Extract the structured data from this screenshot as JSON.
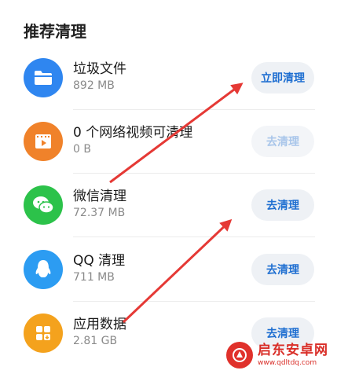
{
  "section": {
    "title": "推荐清理"
  },
  "items": [
    {
      "title": "垃圾文件",
      "size": "892 MB",
      "button": "立即清理",
      "icon": "folder-icon",
      "icon_color": "#2f86f0"
    },
    {
      "title": "0 个网络视频可清理",
      "size": "0 B",
      "button": "去清理",
      "icon": "video-icon",
      "icon_color": "#f0822a"
    },
    {
      "title": "微信清理",
      "size": "72.37 MB",
      "button": "去清理",
      "icon": "wechat-icon",
      "icon_color": "#2cc24a"
    },
    {
      "title": "QQ 清理",
      "size": "711 MB",
      "button": "去清理",
      "icon": "qq-icon",
      "icon_color": "#2c9cf2"
    },
    {
      "title": "应用数据",
      "size": "2.81 GB",
      "button": "去清理",
      "icon": "app-grid-icon",
      "icon_color": "#f4a21d"
    }
  ],
  "watermark": {
    "name": "启东安卓网",
    "url": "www.qdltdq.com"
  },
  "colors": {
    "button_text": "#1f6fd1",
    "button_bg": "#eef1f5",
    "arrow": "#e53935"
  }
}
